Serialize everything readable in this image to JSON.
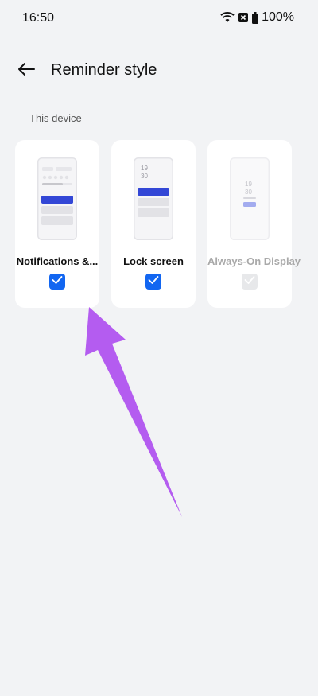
{
  "status_bar": {
    "time": "16:50",
    "battery": "100%"
  },
  "header": {
    "title": "Reminder style",
    "back_icon": "arrow-left-icon"
  },
  "section": {
    "label": "This device"
  },
  "cards": [
    {
      "label": "Notifications &...",
      "checked": true,
      "disabled": false
    },
    {
      "label": "Lock screen",
      "checked": true,
      "disabled": false
    },
    {
      "label": "Always-On Display",
      "checked": false,
      "disabled": true
    }
  ],
  "lock_preview": {
    "hour": "19",
    "minute": "30"
  },
  "aod_preview": {
    "hour": "19",
    "minute": "30"
  },
  "colors": {
    "accent": "#1266f1",
    "annotation_arrow": "#b45cf0",
    "preview_highlight": "#3347d6"
  }
}
